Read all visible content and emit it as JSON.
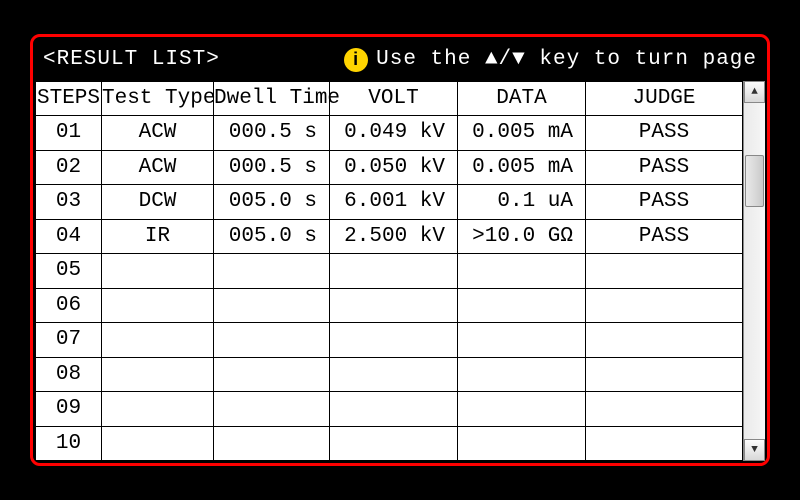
{
  "title": "<RESULT LIST>",
  "hint": "Use the ▲/▼ key to turn page",
  "info_glyph": "i",
  "columns": {
    "steps": "STEPS",
    "type": "Test Type",
    "dwell": "Dwell Time",
    "volt": "VOLT",
    "data": "DATA",
    "judge": "JUDGE"
  },
  "rows": [
    {
      "step": "01",
      "type": "ACW",
      "dwell": "000.5 s",
      "volt": "0.049 kV",
      "data": "0.005 mA",
      "judge": "PASS"
    },
    {
      "step": "02",
      "type": "ACW",
      "dwell": "000.5 s",
      "volt": "0.050 kV",
      "data": "0.005 mA",
      "judge": "PASS"
    },
    {
      "step": "03",
      "type": "DCW",
      "dwell": "005.0 s",
      "volt": "6.001 kV",
      "data": "0.1 uA",
      "judge": "PASS"
    },
    {
      "step": "04",
      "type": "IR",
      "dwell": "005.0 s",
      "volt": "2.500 kV",
      "data": ">10.0 GΩ",
      "judge": "PASS"
    },
    {
      "step": "05",
      "type": "",
      "dwell": "",
      "volt": "",
      "data": "",
      "judge": ""
    },
    {
      "step": "06",
      "type": "",
      "dwell": "",
      "volt": "",
      "data": "",
      "judge": ""
    },
    {
      "step": "07",
      "type": "",
      "dwell": "",
      "volt": "",
      "data": "",
      "judge": ""
    },
    {
      "step": "08",
      "type": "",
      "dwell": "",
      "volt": "",
      "data": "",
      "judge": ""
    },
    {
      "step": "09",
      "type": "",
      "dwell": "",
      "volt": "",
      "data": "",
      "judge": ""
    },
    {
      "step": "10",
      "type": "",
      "dwell": "",
      "volt": "",
      "data": "",
      "judge": ""
    }
  ],
  "scroll": {
    "up": "▲",
    "down": "▼"
  },
  "chart_data": {
    "type": "table",
    "columns": [
      "STEPS",
      "Test Type",
      "Dwell Time",
      "VOLT",
      "DATA",
      "JUDGE"
    ],
    "rows": [
      [
        "01",
        "ACW",
        "000.5 s",
        "0.049 kV",
        "0.005 mA",
        "PASS"
      ],
      [
        "02",
        "ACW",
        "000.5 s",
        "0.050 kV",
        "0.005 mA",
        "PASS"
      ],
      [
        "03",
        "DCW",
        "005.0 s",
        "6.001 kV",
        "0.1 uA",
        "PASS"
      ],
      [
        "04",
        "IR",
        "005.0 s",
        "2.500 kV",
        ">10.0 GΩ",
        "PASS"
      ],
      [
        "05",
        "",
        "",
        "",
        "",
        ""
      ],
      [
        "06",
        "",
        "",
        "",
        "",
        ""
      ],
      [
        "07",
        "",
        "",
        "",
        "",
        ""
      ],
      [
        "08",
        "",
        "",
        "",
        "",
        ""
      ],
      [
        "09",
        "",
        "",
        "",
        "",
        ""
      ],
      [
        "10",
        "",
        "",
        "",
        "",
        ""
      ]
    ],
    "title": "RESULT LIST"
  }
}
